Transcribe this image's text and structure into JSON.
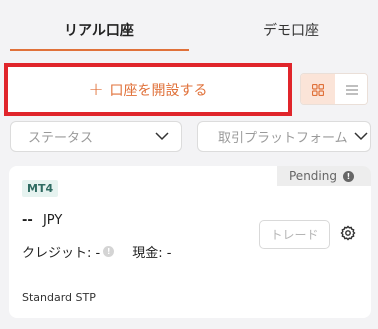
{
  "tabs": {
    "real": "リアル口座",
    "demo": "デモ口座"
  },
  "actions": {
    "open_account": "口座を開設する",
    "plus": "+"
  },
  "filters": {
    "status_placeholder": "ステータス",
    "platform_placeholder": "取引プラットフォーム"
  },
  "account": {
    "platform": "MT4",
    "status": "Pending",
    "status_info": "!",
    "balance_value": "--",
    "currency": "JPY",
    "credit_label": "クレジット: -",
    "credit_info": "!",
    "cash_label": "現金: -",
    "trade_label": "トレード",
    "account_type": "Standard STP"
  },
  "colors": {
    "accent": "#e0713a",
    "highlight_border": "#e0252b"
  }
}
